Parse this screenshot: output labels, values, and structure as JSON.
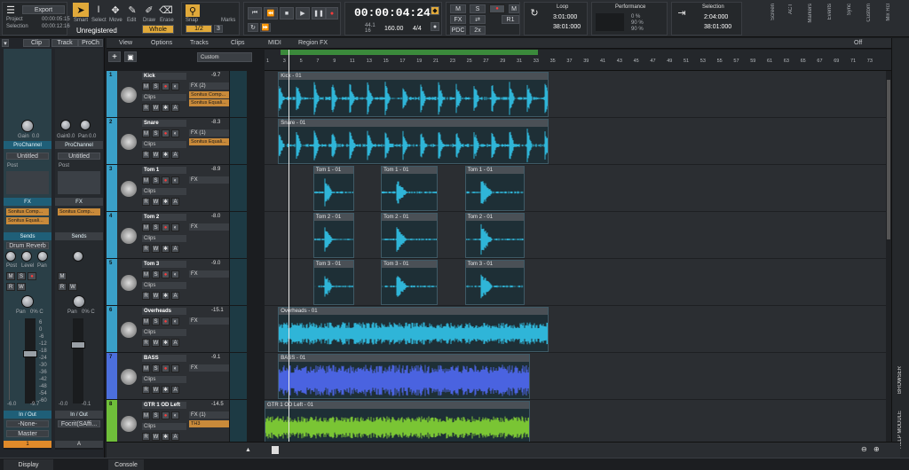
{
  "control_bar": {
    "export_label": "Export",
    "project_label": "Project",
    "project_time": "00:00:05:15",
    "selection_label": "Selection",
    "selection_time": "00:00:12:16",
    "status": "Unregistered",
    "tools": [
      "Smart",
      "Select",
      "Move",
      "Edit",
      "Draw",
      "Erase"
    ],
    "snap_label": "Snap",
    "snap_value": "Whole",
    "snap_fraction": "1/2",
    "marks_label": "Marks",
    "marks_value": "3",
    "timecode": "00:00:04:24",
    "sample_rate": "44.1",
    "bit_depth": "16",
    "tempo": "160.00",
    "meter": "4/4",
    "mix_buttons": [
      "M",
      "S",
      "●",
      "M",
      "FX",
      "⇄",
      "PDC",
      "2x",
      "R1"
    ],
    "loop_label": "Loop",
    "loop_start": "3:01:000",
    "loop_end": "38:01:000",
    "performance_label": "Performance",
    "perf_rows": [
      "0 %",
      "90 %",
      "90 %"
    ],
    "selection_module_label": "Selection",
    "sel_start": "2:04:000",
    "sel_end": "38:01:000",
    "side_modules": [
      "Screen",
      "ACT",
      "Markers",
      "Events",
      "Sync",
      "Custom",
      "Mix Rcl"
    ]
  },
  "inspector": {
    "tabs": [
      "Clip",
      "Track",
      "ProCh"
    ],
    "left_strip": {
      "gain_label": "Gain",
      "gain_value": "0.0",
      "prochannel": "ProChannel",
      "preset": "Untitled",
      "post_label": "Post",
      "fx_label": "FX",
      "fx_items": [
        "Sonitus Comp...",
        "Sonitus Equali..."
      ],
      "sends_label": "Sends",
      "send_name": "Drum Reverb",
      "send_labels": [
        "Post",
        "Level",
        "Pan"
      ],
      "pan_label": "Pan",
      "pan_value": "0% C",
      "scale": [
        "6",
        "0",
        "-6",
        "-12",
        "-18",
        "-24",
        "-30",
        "-36",
        "-42",
        "-48",
        "-54",
        "-60"
      ],
      "fader_values": [
        "-6.0",
        "-9.7"
      ],
      "io_label": "In / Out",
      "input": "-None-",
      "output": "Master",
      "name": "Kick",
      "number": "1"
    },
    "right_strip": {
      "gain_label": "Gain",
      "gain_value": "0.0",
      "pan_label": "Pan",
      "pan_value": "0.0",
      "prochannel": "ProChannel",
      "preset": "Untitled",
      "post_label": "Post",
      "fx_label": "FX",
      "fx_items": [
        "Sonitus Comp..."
      ],
      "sends_label": "Sends",
      "pan_label2": "Pan",
      "pan_value2": "0% C",
      "fader_values": [
        "-0.0",
        "-0.1"
      ],
      "io_label": "In / Out",
      "output": "Focrit(SAffi...",
      "name": "Master",
      "number": "A"
    },
    "display_tab": "Display"
  },
  "menu": {
    "items": [
      "View",
      "Options",
      "Tracks",
      "Clips",
      "MIDI",
      "Region FX"
    ],
    "custom_label": "Custom",
    "off_label": "Off"
  },
  "ruler": {
    "ticks": [
      "1",
      "3",
      "5",
      "7",
      "9",
      "11",
      "13",
      "15",
      "17",
      "19",
      "21",
      "23",
      "25",
      "27",
      "29",
      "31",
      "33",
      "35",
      "37",
      "39",
      "41",
      "43",
      "45",
      "47",
      "49",
      "51",
      "53",
      "55",
      "57",
      "59",
      "61",
      "63",
      "65",
      "67",
      "69",
      "71",
      "73"
    ]
  },
  "tracks": [
    {
      "num": "1",
      "name": "Kick",
      "vol": "-9.7",
      "fx": "FX (2)",
      "plugins": [
        "Sonitus Comp...",
        "Sonitus Equali..."
      ],
      "clips_label": "Clips",
      "color": "#3aa0c8",
      "inst": "kick-drum-icon"
    },
    {
      "num": "2",
      "name": "Snare",
      "vol": "-8.3",
      "fx": "FX (1)",
      "plugins": [
        "Sonitus Equali..."
      ],
      "clips_label": "Clips",
      "color": "#3aa0c8",
      "inst": "snare-drum-icon"
    },
    {
      "num": "3",
      "name": "Tom 1",
      "vol": "-8.9",
      "fx": "FX",
      "plugins": [],
      "clips_label": "Clips",
      "color": "#3aa0c8",
      "inst": "tom-drum-icon"
    },
    {
      "num": "4",
      "name": "Tom 2",
      "vol": "-8.0",
      "fx": "FX",
      "plugins": [],
      "clips_label": "Clips",
      "color": "#3aa0c8",
      "inst": "tom-drum-icon"
    },
    {
      "num": "5",
      "name": "Tom 3",
      "vol": "-9.0",
      "fx": "FX",
      "plugins": [],
      "clips_label": "Clips",
      "color": "#3aa0c8",
      "inst": "floor-tom-icon"
    },
    {
      "num": "6",
      "name": "Overheads",
      "vol": "-15.1",
      "fx": "FX",
      "plugins": [],
      "clips_label": "Clips",
      "color": "#3aa0c8",
      "inst": "cymbal-icon"
    },
    {
      "num": "7",
      "name": "BASS",
      "vol": "-9.1",
      "fx": "FX",
      "plugins": [],
      "clips_label": "Clips",
      "color": "#4c6fdc",
      "inst": "bass-guitar-icon"
    },
    {
      "num": "8",
      "name": "GTR 1 OD Left",
      "vol": "-14.5",
      "fx": "FX (1)",
      "plugins": [
        "TH3"
      ],
      "clips_label": "Clips",
      "color": "#6fbf3a",
      "inst": "guitar-icon"
    }
  ],
  "clips": [
    [
      {
        "name": "Kick - 01",
        "start": 0.5,
        "end": 10.5
      }
    ],
    [
      {
        "name": "Snare - 01",
        "start": 0.5,
        "end": 10.5
      }
    ],
    [
      {
        "name": "Tom 1 - 01",
        "start": 1.8,
        "end": 3.3
      },
      {
        "name": "Tom 1 - 01",
        "start": 4.3,
        "end": 6.4
      },
      {
        "name": "Tom 1 - 01",
        "start": 7.4,
        "end": 9.6
      }
    ],
    [
      {
        "name": "Tom 2 - 01",
        "start": 1.8,
        "end": 3.3
      },
      {
        "name": "Tom 2 - 01",
        "start": 4.3,
        "end": 6.4
      },
      {
        "name": "Tom 2 - 01",
        "start": 7.4,
        "end": 9.6
      }
    ],
    [
      {
        "name": "Tom 3 - 01",
        "start": 1.8,
        "end": 3.3
      },
      {
        "name": "Tom 3 - 01",
        "start": 4.3,
        "end": 6.4
      },
      {
        "name": "Tom 3 - 01",
        "start": 7.4,
        "end": 9.6
      }
    ],
    [
      {
        "name": "Overheads - 01",
        "start": 0.5,
        "end": 10.5
      }
    ],
    [
      {
        "name": "BASS - 01",
        "start": 0.5,
        "end": 9.8
      }
    ],
    [
      {
        "name": "GTR 1 OD Left - 01",
        "start": 0.0,
        "end": 9.8
      }
    ]
  ],
  "clip_colors": {
    "drums": "#2fb5d8",
    "bass": "#4a63e0",
    "guitar": "#7ac534"
  },
  "bottom": {
    "console_tab": "Console",
    "browser_tab": "BROWSER",
    "help_tab": "HELP MODULE"
  }
}
